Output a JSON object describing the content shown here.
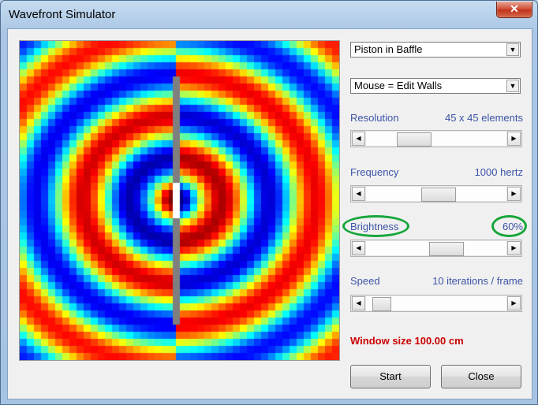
{
  "window": {
    "title": "Wavefront Simulator",
    "close_glyph": "✕"
  },
  "source_select": {
    "value": "Piston in Baffle",
    "arrow": "▼"
  },
  "mouse_select": {
    "value": "Mouse = Edit Walls",
    "arrow": "▼"
  },
  "resolution": {
    "label": "Resolution",
    "value_text": "45 x 45 elements",
    "position": 0.29
  },
  "frequency": {
    "label": "Frequency",
    "value_text": "1000 hertz",
    "position": 0.52
  },
  "brightness": {
    "label": "Brightness",
    "value_text": "60%",
    "position": 0.6
  },
  "speed": {
    "label": "Speed",
    "value_text": "10 iterations / frame",
    "position": 0.05
  },
  "scroll_glyphs": {
    "left": "◀",
    "right": "▶"
  },
  "window_size": {
    "text": "Window size 100.00 cm"
  },
  "buttons": {
    "start": "Start",
    "close": "Close"
  },
  "simulation": {
    "grid": 45,
    "wavelength_cells": 13.2,
    "baffle_color": "#7f7f7f"
  },
  "colors": {
    "label_blue": "#3c54a8",
    "highlight_ring": "#17a63a",
    "warning_red": "#cc0000"
  }
}
